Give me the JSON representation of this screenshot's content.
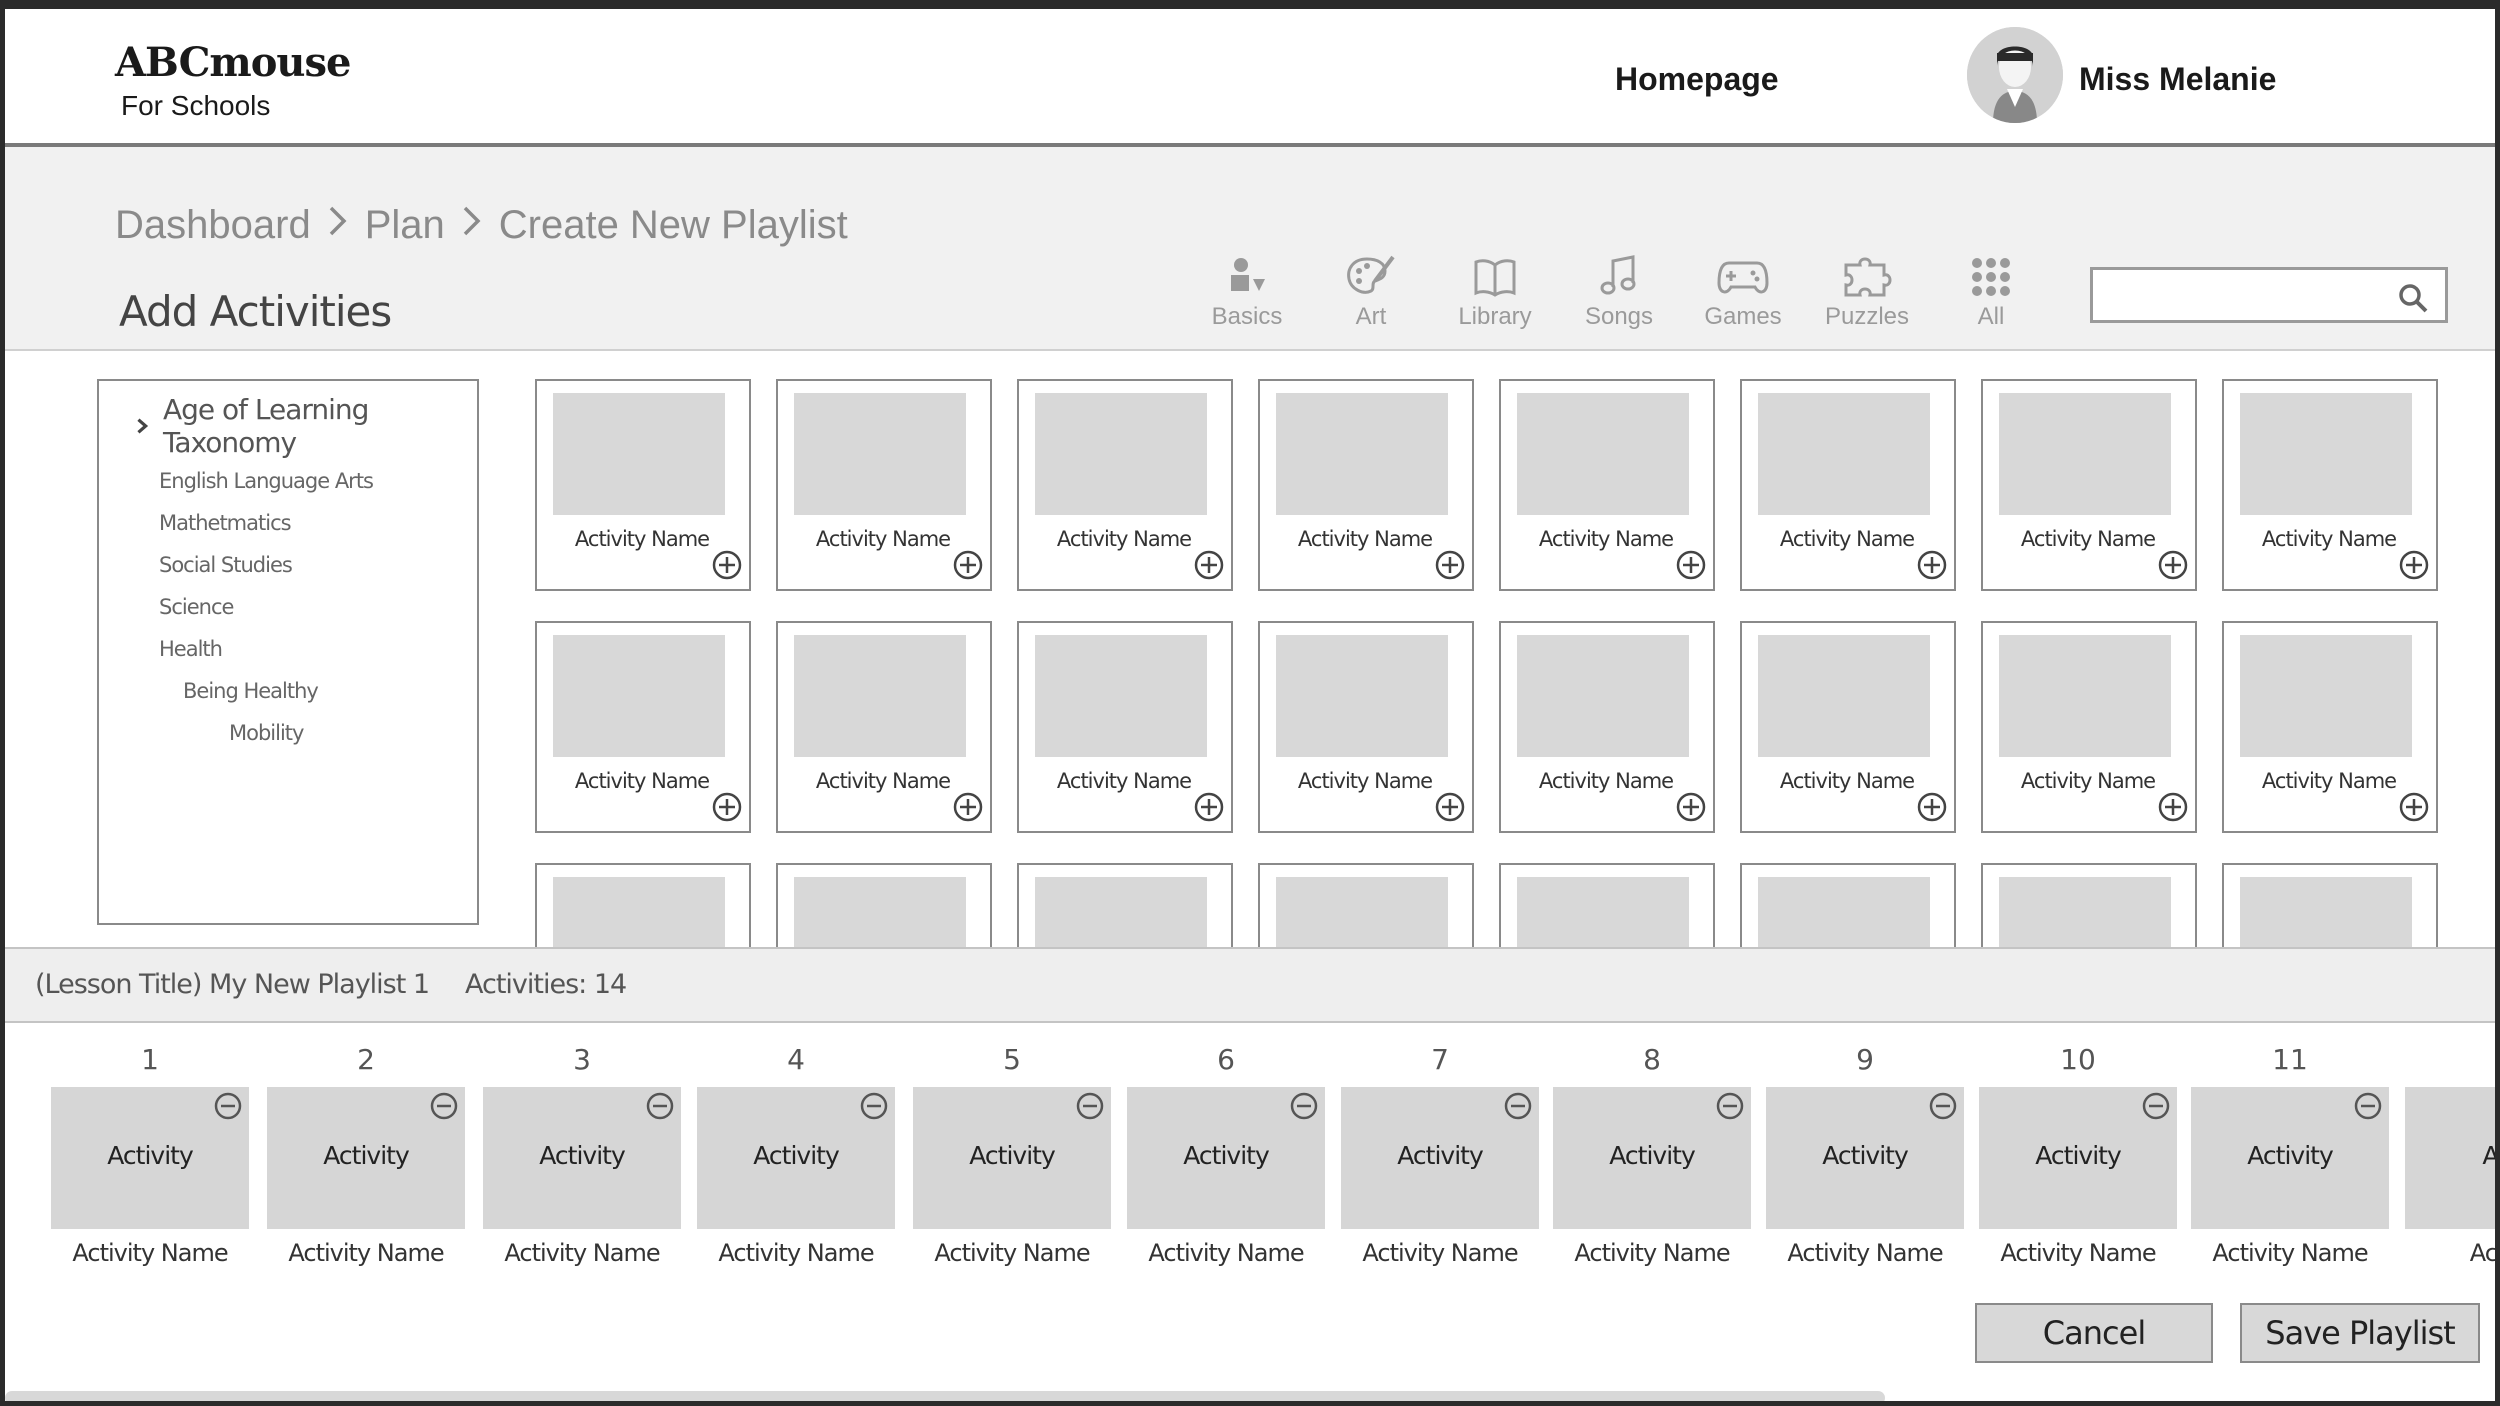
{
  "header": {
    "logo_main": "ABCmouse",
    "logo_sub": "For Schools",
    "home_link": "Homepage",
    "user_name": "Miss Melanie"
  },
  "breadcrumb": [
    "Dashboard",
    "Plan",
    "Create New Playlist"
  ],
  "section_title": "Add Activities",
  "categories": [
    {
      "label": "Basics",
      "icon": "basics-icon"
    },
    {
      "label": "Art",
      "icon": "palette-icon"
    },
    {
      "label": "Library",
      "icon": "book-icon"
    },
    {
      "label": "Songs",
      "icon": "music-note-icon"
    },
    {
      "label": "Games",
      "icon": "gamepad-icon"
    },
    {
      "label": "Puzzles",
      "icon": "puzzle-icon"
    },
    {
      "label": "All",
      "icon": "grid-icon"
    }
  ],
  "search": {
    "placeholder": ""
  },
  "taxonomy": {
    "title": "Age of Learning Taxonomy",
    "items": [
      {
        "label": "English Language Arts",
        "level": 0
      },
      {
        "label": "Mathetmatics",
        "level": 0
      },
      {
        "label": "Social Studies",
        "level": 0
      },
      {
        "label": "Science",
        "level": 0
      },
      {
        "label": "Health",
        "level": 0
      },
      {
        "label": "Being Healthy",
        "level": 1
      },
      {
        "label": "Mobility",
        "level": 2
      }
    ]
  },
  "activity_card_label": "Activity Name",
  "playlist": {
    "title": "(Lesson Title) My New Playlist 1",
    "count_label": "Activities: 14",
    "items": [
      {
        "number": "1",
        "box_label": "Activity",
        "name": "Activity Name"
      },
      {
        "number": "2",
        "box_label": "Activity",
        "name": "Activity Name"
      },
      {
        "number": "3",
        "box_label": "Activity",
        "name": "Activity Name"
      },
      {
        "number": "4",
        "box_label": "Activity",
        "name": "Activity Name"
      },
      {
        "number": "5",
        "box_label": "Activity",
        "name": "Activity Name"
      },
      {
        "number": "6",
        "box_label": "Activity",
        "name": "Activity Name"
      },
      {
        "number": "7",
        "box_label": "Activity",
        "name": "Activity Name"
      },
      {
        "number": "8",
        "box_label": "Activity",
        "name": "Activity Name"
      },
      {
        "number": "9",
        "box_label": "Activity",
        "name": "Activity Name"
      },
      {
        "number": "10",
        "box_label": "Activity",
        "name": "Activity Name"
      },
      {
        "number": "11",
        "box_label": "Activity",
        "name": "Activity Name"
      },
      {
        "number": "",
        "box_label": "Acti",
        "name": "Activit"
      }
    ]
  },
  "buttons": {
    "cancel": "Cancel",
    "save": "Save Playlist"
  }
}
